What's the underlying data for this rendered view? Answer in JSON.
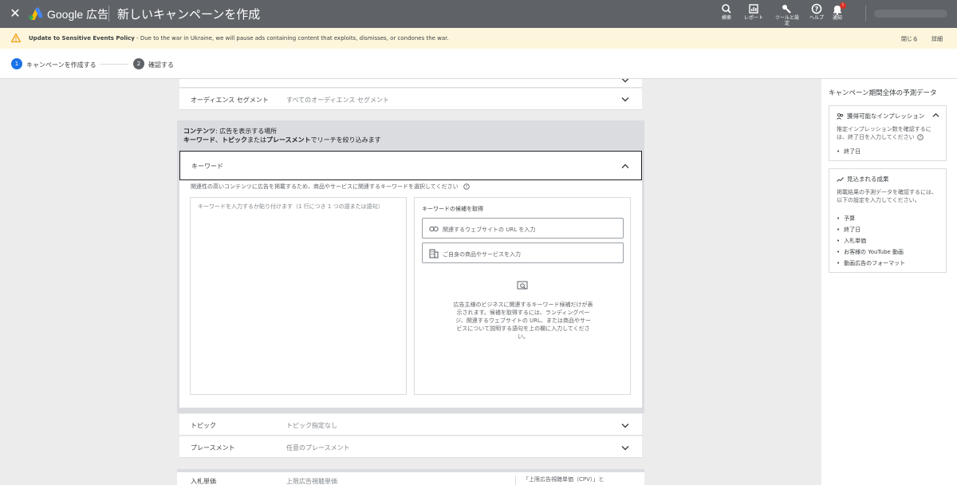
{
  "header": {
    "brand": "Google 広告",
    "title": "新しいキャンペーンを作成",
    "tools": [
      {
        "label": "検索",
        "icon": "search-icon"
      },
      {
        "label": "レポート",
        "icon": "report-icon"
      },
      {
        "label": "ツールと設定",
        "icon": "wrench-icon"
      },
      {
        "label": "ヘルプ",
        "icon": "help-icon"
      },
      {
        "label": "通知",
        "icon": "bell-icon",
        "badge": "!"
      }
    ]
  },
  "banner": {
    "title": "Update to Sensitive Events Policy",
    "message": " - Due to the war in Ukraine, we will pause ads containing content that exploits, dismisses, or condones the war.",
    "close": "閉じる",
    "details": "詳細"
  },
  "steps": [
    {
      "number": "1",
      "label": "キャンペーンを作成する",
      "color": "#1a73e8"
    },
    {
      "number": "2",
      "label": "確認する",
      "color": "#5f6368"
    }
  ],
  "rows": {
    "audience": {
      "label": "オーディエンス セグメント",
      "value": "すべてのオーディエンス セグメント"
    },
    "topic": {
      "label": "トピック",
      "value": "トピック指定なし"
    },
    "placement": {
      "label": "プレースメント",
      "value": "任意のプレースメント"
    },
    "bidding": {
      "label": "入札単価",
      "value": "上限広告視聴単価",
      "note": "「上限広告視聴単価（CPV）」と"
    }
  },
  "content": {
    "heading_bold": "コンテンツ",
    "heading_rest": ": 広告を表示する場所",
    "sub_1": "キーワード",
    "sub_2": "、",
    "sub_3": "トピック",
    "sub_4": "または",
    "sub_5": "プレースメント",
    "sub_6": "でリーチを絞り込みます",
    "keyword_label": "キーワード",
    "keyword_desc": "関連性の高いコンテンツに広告を掲載するため、商品やサービスに関連するキーワードを選択してください",
    "keyword_input_placeholder": "キーワードを入力するか貼り付けます（1 行につき 1 つの語または語句）",
    "suggest_title": "キーワードの候補を取得",
    "url_placeholder": "関連するウェブサイトの URL を入力",
    "product_placeholder": "ご自身の商品やサービスを入力",
    "empty_text": "広告主様のビジネスに関連するキーワード候補だけが表示されます。候補を取得するには、ランディングページ、関連するウェブサイトの URL、または商品やサービスについて説明する語句を上の欄に入力してください。"
  },
  "forecast": {
    "title": "キャンペーン期間全体の予測データ",
    "impressions": {
      "title": "獲得可能なインプレッション",
      "body": "推定インプレッション数を確認するには、終了日を入力してください",
      "items": [
        "終了日"
      ]
    },
    "results": {
      "title": "見込まれる成果",
      "body": "掲載結果の予測データを確認するには、以下の設定を入力してください。",
      "items": [
        "予算",
        "終了日",
        "入札単価",
        "お客様の YouTube 動画",
        "動画広告のフォーマット"
      ]
    }
  }
}
